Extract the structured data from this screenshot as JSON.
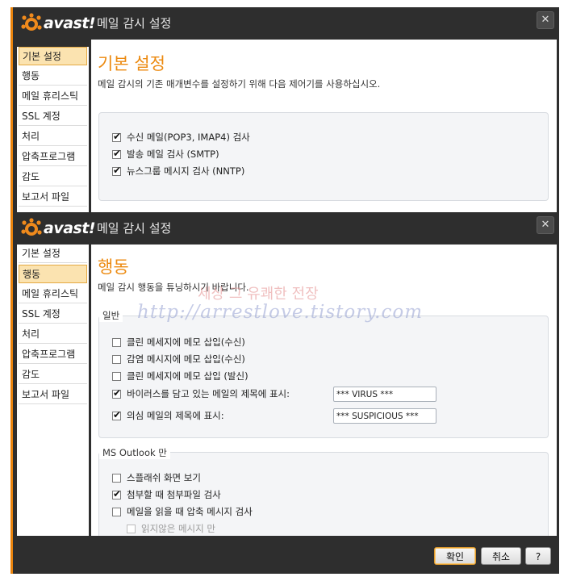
{
  "window1": {
    "brand": "avast!",
    "title": "메일 감시 설정",
    "close": "✕",
    "nav": [
      {
        "label": "기본 설정",
        "active": true
      },
      {
        "label": "행동",
        "active": false
      },
      {
        "label": "메일 휴리스틱",
        "active": false
      },
      {
        "label": "SSL 계정",
        "active": false
      },
      {
        "label": "처리",
        "active": false
      },
      {
        "label": "압축프로그램",
        "active": false
      },
      {
        "label": "감도",
        "active": false
      },
      {
        "label": "보고서 파일",
        "active": false
      }
    ],
    "heading": "기본 설정",
    "description": "메일 감시의 기존 매개변수를 설정하기 위해 다음 제어기를 사용하십시오.",
    "options": [
      {
        "label": "수신 메일(POP3, IMAP4) 검사",
        "checked": true
      },
      {
        "label": "발송 메일 검사 (SMTP)",
        "checked": true
      },
      {
        "label": "뉴스그룹 메시지 검사 (NNTP)",
        "checked": true
      }
    ]
  },
  "window2": {
    "brand": "avast!",
    "title": "메일 감시 설정",
    "close": "✕",
    "nav": [
      {
        "label": "기본 설정",
        "active": false
      },
      {
        "label": "행동",
        "active": true
      },
      {
        "label": "메일 휴리스틱",
        "active": false
      },
      {
        "label": "SSL 계정",
        "active": false
      },
      {
        "label": "처리",
        "active": false
      },
      {
        "label": "압축프로그램",
        "active": false
      },
      {
        "label": "감도",
        "active": false
      },
      {
        "label": "보고서 파일",
        "active": false
      }
    ],
    "heading": "행동",
    "description": "메일 감시 행동을 튜닝하시기 바랍니다.",
    "general": {
      "label": "일반",
      "options": [
        {
          "label": "클린 메세지에 메모 삽입(수신)",
          "checked": false
        },
        {
          "label": "감염 메시지에 메모 삽입(수신)",
          "checked": false
        },
        {
          "label": "클린 메세지에 메모 삽입 (발신)",
          "checked": false
        },
        {
          "label": "바이러스를 담고 있는 메일의 제목에 표시:",
          "checked": true
        },
        {
          "label": "의심 메일의 제목에 표시:",
          "checked": true
        }
      ],
      "virus_tag": "*** VIRUS ***",
      "suspicious_tag": "*** SUSPICIOUS ***"
    },
    "outlook": {
      "label": "MS Outlook 만",
      "options": [
        {
          "label": "스플래쉬 화면 보기",
          "checked": false
        },
        {
          "label": "첨부할 때 첨부파일 검사",
          "checked": true
        },
        {
          "label": "메일을 읽을 때 압축 메시지 검사",
          "checked": false
        },
        {
          "label": "읽지않은 메시지 만",
          "checked": false
        }
      ]
    },
    "buttons": {
      "ok": "확인",
      "cancel": "취소",
      "help": "?"
    }
  },
  "watermark": {
    "line1": "세상 그 유쾌한 전장",
    "line2": "http://arrestlove.tistory.com"
  },
  "colors": {
    "accent": "#ec8a10",
    "frame": "#2e2e2e",
    "active_nav": "#fbe3b0"
  }
}
